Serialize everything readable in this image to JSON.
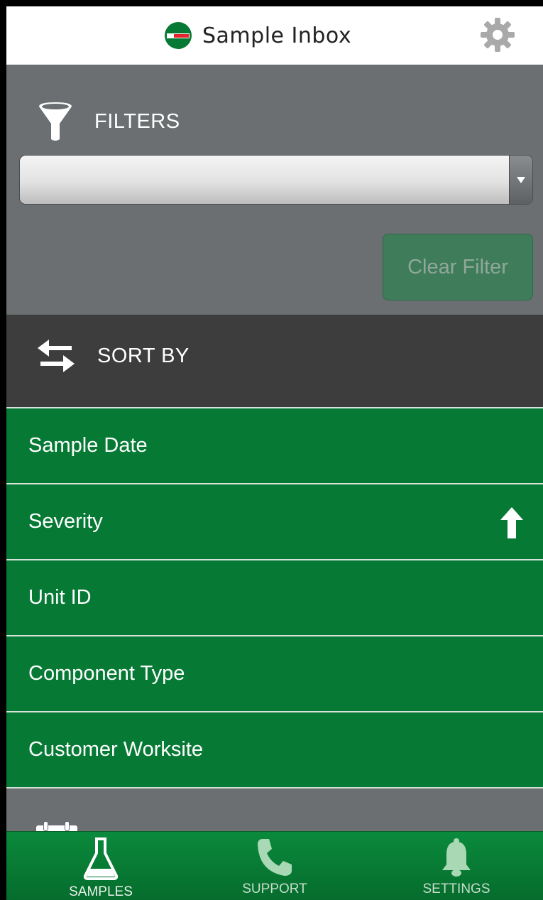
{
  "header": {
    "title": "Sample Inbox",
    "logo_icon": "brand-logo-icon",
    "settings_icon": "gear-icon"
  },
  "filters": {
    "label": "FILTERS",
    "icon": "funnel-icon",
    "select_value": "",
    "clear_button": "Clear Filter"
  },
  "sort": {
    "label": "SORT BY",
    "icon": "swap-arrows-icon",
    "items": [
      {
        "label": "Sample Date",
        "active": false
      },
      {
        "label": "Severity",
        "active": true,
        "direction": "ascending"
      },
      {
        "label": "Unit ID",
        "active": false
      },
      {
        "label": "Component Type",
        "active": false
      },
      {
        "label": "Customer Worksite",
        "active": false
      }
    ]
  },
  "date_range": {
    "icon": "calendar-icon"
  },
  "tabbar": {
    "tabs": [
      {
        "label": "SAMPLES",
        "icon": "flask-icon",
        "active": true
      },
      {
        "label": "SUPPORT",
        "icon": "phone-icon",
        "active": false
      },
      {
        "label": "SETTINGS",
        "icon": "bell-icon",
        "active": false
      }
    ]
  },
  "colors": {
    "brand_green": "#067a35",
    "panel_gray": "#6b6f71",
    "sort_header": "#3d3d3d",
    "clear_button": "#3f7c5a",
    "logo_red": "#e4232b"
  }
}
